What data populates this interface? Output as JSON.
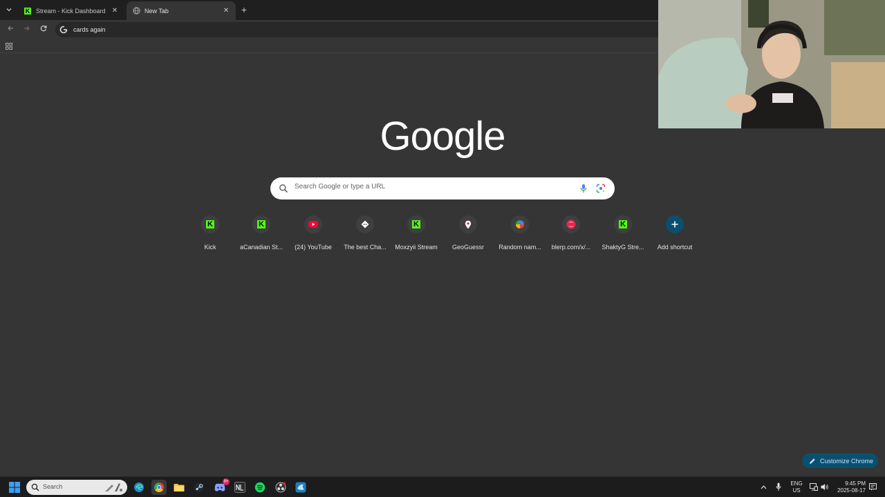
{
  "tabs": [
    {
      "title": "Stream - Kick Dashboard",
      "active": false
    },
    {
      "title": "New Tab",
      "active": true
    }
  ],
  "omnibox": {
    "text": "cards again"
  },
  "logo": {
    "text": "Google"
  },
  "search": {
    "placeholder": "Search Google or type a URL"
  },
  "shortcuts": [
    {
      "label": "Kick",
      "icon": "kick-icon"
    },
    {
      "label": "aCanadian St...",
      "icon": "kick-icon"
    },
    {
      "label": "(24) YouTube",
      "icon": "youtube-icon"
    },
    {
      "label": "The best Cha...",
      "icon": "chat-icon"
    },
    {
      "label": "Moxzyii Stream",
      "icon": "kick-icon"
    },
    {
      "label": "GeoGuessr",
      "icon": "map-pin-icon"
    },
    {
      "label": "Random nam...",
      "icon": "wheel-icon"
    },
    {
      "label": "blerp.com/x/...",
      "icon": "blerp-icon"
    },
    {
      "label": "ShaktyG Stre...",
      "icon": "kick-icon"
    },
    {
      "label": "Add shortcut",
      "icon": "plus-icon"
    }
  ],
  "customize": {
    "label": "Customize Chrome"
  },
  "taskbar": {
    "search_placeholder": "Search",
    "discord_badge": "9+",
    "lang_line1": "ENG",
    "lang_line2": "US",
    "time": "9:45 PM",
    "date": "2025-08-17"
  },
  "colors": {
    "page_bg": "#353535",
    "tab_strip": "#1f1f1f",
    "kick_green": "#53fc18",
    "customize_bg": "#0b4f6f",
    "customize_text": "#c4e7ff"
  }
}
